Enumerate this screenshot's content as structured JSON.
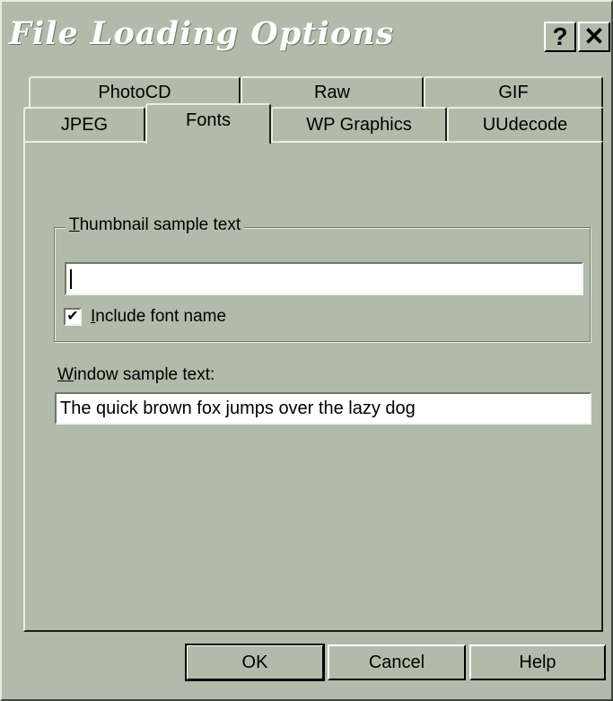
{
  "window": {
    "title": "File Loading Options",
    "help_label": "?",
    "close_label": "✕"
  },
  "tabs": {
    "row_back": [
      "PhotoCD",
      "Raw",
      "GIF"
    ],
    "row_front": [
      "JPEG",
      "Fonts",
      "WP Graphics",
      "UUdecode"
    ],
    "active": "Fonts"
  },
  "fonts_panel": {
    "thumbnail_group": {
      "legend_accel": "T",
      "legend_rest": "humbnail sample text",
      "input_value": "",
      "include_font_name": {
        "checked": true,
        "check_glyph": "✔",
        "label_accel": "I",
        "label_rest": "nclude font name"
      }
    },
    "window_sample": {
      "label_accel": "W",
      "label_rest": "indow sample text:",
      "value": "The quick brown fox jumps over the lazy dog"
    }
  },
  "buttons": {
    "ok": "OK",
    "cancel": "Cancel",
    "help": "Help"
  },
  "colors": {
    "face": "#b2bba9",
    "title_text": "#ffffff"
  }
}
